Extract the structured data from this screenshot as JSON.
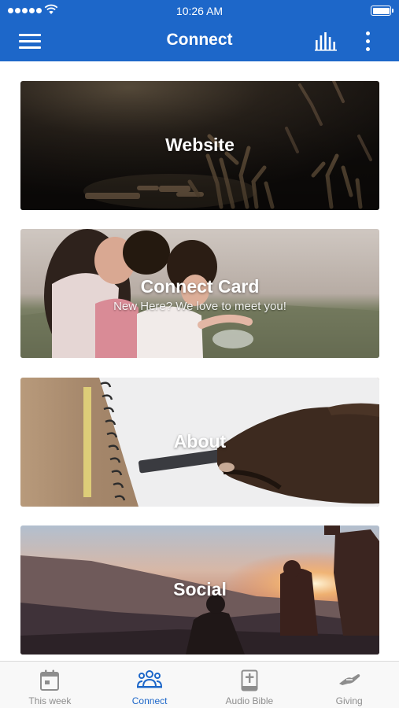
{
  "status_bar": {
    "time": "10:26 AM",
    "battery_level": 1.0
  },
  "nav": {
    "title": "Connect",
    "menu_icon": "hamburger-menu-icon",
    "stats_icon": "bar-chart-icon",
    "more_icon": "more-vertical-icon"
  },
  "cards": [
    {
      "title": "Website",
      "subtitle": "",
      "image": "worship-hands-raised"
    },
    {
      "title": "Connect Card",
      "subtitle": "New Here? We love to meet you!",
      "image": "children-hugging"
    },
    {
      "title": "About",
      "subtitle": "",
      "image": "hand-on-notebook"
    },
    {
      "title": "Social",
      "subtitle": "",
      "image": "sunset-hikers"
    }
  ],
  "tabs": [
    {
      "label": "This week",
      "icon": "calendar-icon",
      "active": false
    },
    {
      "label": "Connect",
      "icon": "people-icon",
      "active": true
    },
    {
      "label": "Audio Bible",
      "icon": "bible-icon",
      "active": false
    },
    {
      "label": "Giving",
      "icon": "giving-hand-icon",
      "active": false
    }
  ],
  "colors": {
    "brand": "#1d67c9",
    "inactive_tab": "#8d8d8d",
    "tab_bar_bg": "#f8f8f8"
  }
}
